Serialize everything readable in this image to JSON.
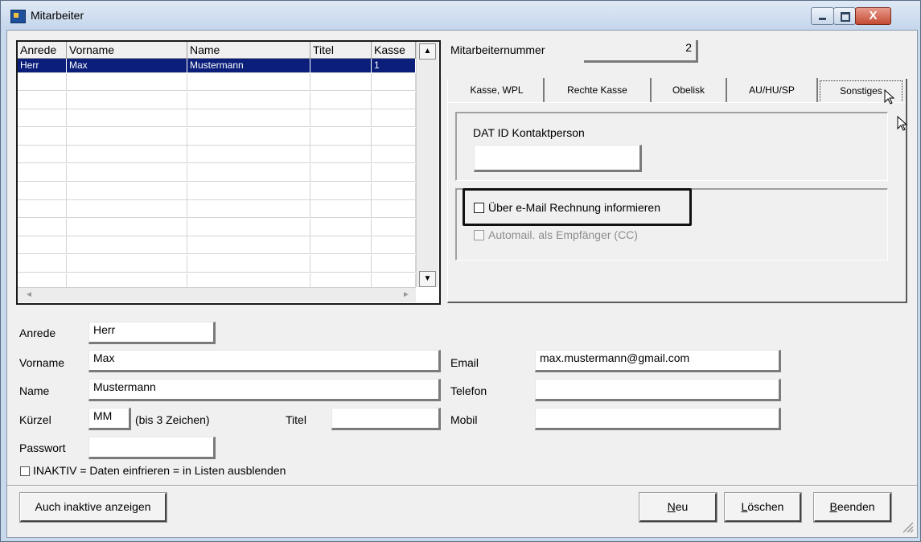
{
  "window": {
    "title": "Mitarbeiter",
    "close_glyph": "X"
  },
  "grid": {
    "columns": [
      "Anrede",
      "Vorname",
      "Name",
      "Titel",
      "Kasse"
    ],
    "rows": [
      [
        "Herr",
        "Max",
        "Mustermann",
        "",
        "1"
      ]
    ],
    "scroll_up": "▲",
    "scroll_down": "▼",
    "scroll_left": "◄",
    "scroll_right": "►"
  },
  "right": {
    "mitarbeiternummer_label": "Mitarbeiternummer",
    "mitarbeiternummer_value": "2",
    "tabs": [
      "Kasse, WPL",
      "Rechte Kasse",
      "Obelisk",
      "AU/HU/SP",
      "Sonstiges"
    ],
    "active_tab": "Sonstiges",
    "dat_id_label": "DAT ID Kontaktperson",
    "dat_id_value": "",
    "email_invoice_label": "Über e-Mail Rechnung informieren",
    "automail_label": "Automail. als Empfänger (CC)"
  },
  "form": {
    "anrede_label": "Anrede",
    "anrede_value": "Herr",
    "vorname_label": "Vorname",
    "vorname_value": "Max",
    "name_label": "Name",
    "name_value": "Mustermann",
    "kuerzel_label": "Kürzel",
    "kuerzel_value": "MM",
    "kuerzel_hint": "(bis 3 Zeichen)",
    "titel_label": "Titel",
    "titel_value": "",
    "passwort_label": "Passwort",
    "passwort_value": "",
    "email_label": "Email",
    "email_value": "max.mustermann@gmail.com",
    "telefon_label": "Telefon",
    "telefon_value": "",
    "mobil_label": "Mobil",
    "mobil_value": "",
    "inaktiv_label": "INAKTIV = Daten einfrieren = in Listen ausblenden"
  },
  "buttons": {
    "show_inactive": "Auch inaktive anzeigen",
    "neu_mnemonic": "N",
    "neu_rest": "eu",
    "loeschen_mnemonic": "L",
    "loeschen_rest": "öschen",
    "beenden_mnemonic": "B",
    "beenden_rest": "eenden"
  }
}
